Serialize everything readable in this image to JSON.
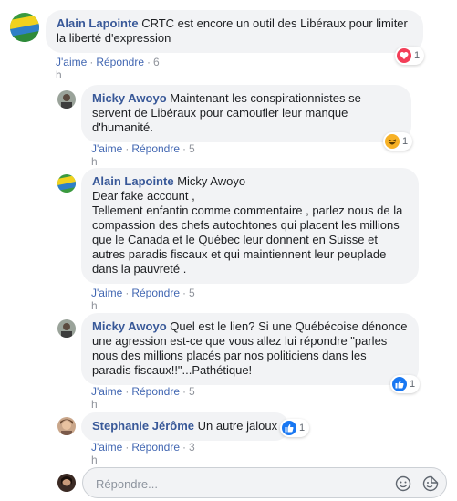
{
  "comments": [
    {
      "author": "Alain Lapointe",
      "text": "CRTC est encore un outil des Libéraux pour limiter la liberté d'expression",
      "like": "J'aime",
      "reply": "Répondre",
      "time": "6 h",
      "reaction_count": "1",
      "reaction": "heart-icon"
    },
    {
      "author": "Micky Awoyo",
      "text": "Maintenant les conspirationnistes se servent de Libéraux pour camoufler leur manque d'humanité.",
      "like": "J'aime",
      "reply": "Répondre",
      "time": "5 h",
      "reaction_count": "1",
      "reaction": "laugh-icon"
    },
    {
      "author": "Alain Lapointe",
      "text": "Micky Awoyo\nDear fake account ,\nTellement enfantin comme commentaire , parlez nous de la compassion des chefs autochtones qui placent les millions que le Canada et le Québec leur donnent en Suisse et autres paradis fiscaux et qui maintiennent leur peuplade dans la pauvreté .",
      "like": "J'aime",
      "reply": "Répondre",
      "time": "5 h"
    },
    {
      "author": "Micky Awoyo",
      "text": "Quel est le lien? Si une Québécoise dénonce une agression est-ce que vous allez lui répondre \"parles nous des millions placés par nos politiciens dans les paradis fiscaux!!\"...Pathétique!",
      "like": "J'aime",
      "reply": "Répondre",
      "time": "5 h",
      "reaction_count": "1",
      "reaction": "like-icon"
    },
    {
      "author": "Stephanie Jérôme",
      "text": "Un autre jaloux",
      "like": "J'aime",
      "reply": "Répondre",
      "time": "3 h",
      "reaction_count": "1",
      "reaction": "like-icon"
    }
  ],
  "reply_box": {
    "placeholder": "Répondre..."
  },
  "colors": {
    "link": "#385898",
    "bubble": "#f2f3f5",
    "like_blue": "#1877f2",
    "heart_red": "#f33e58",
    "laugh_yellow": "#f7b125"
  }
}
